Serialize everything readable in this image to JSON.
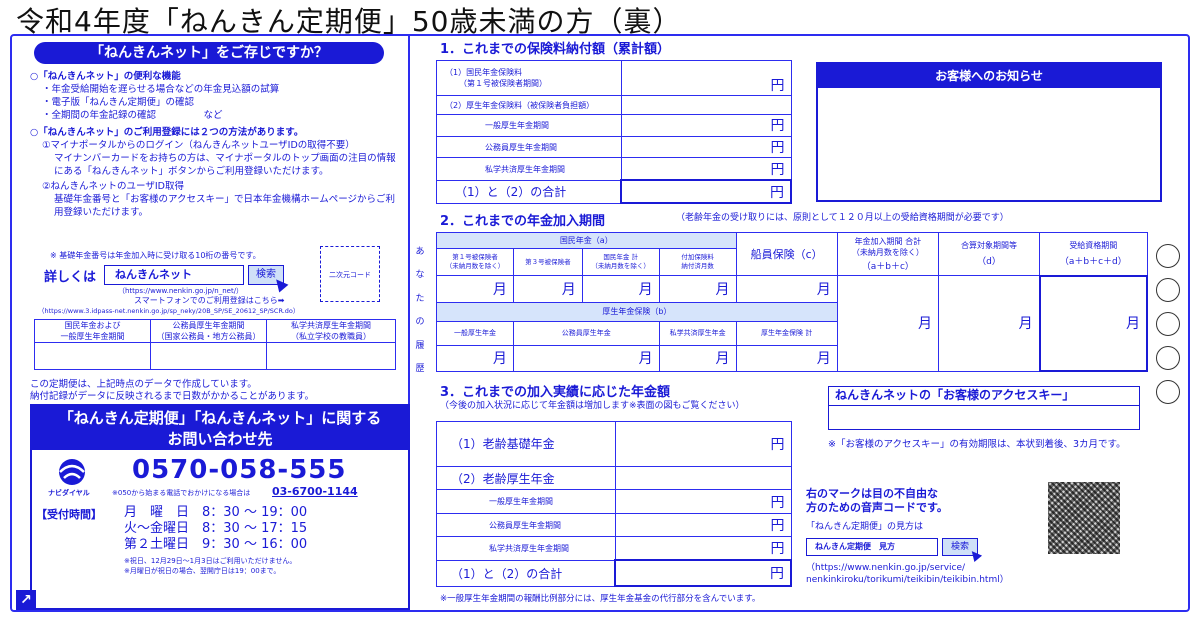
{
  "title": "令和4年度「ねんきん定期便」50歳未満の方（裏）",
  "left": {
    "banner": "「ねんきんネット」をご存じですか？",
    "feature_head": "○「ねんきんネット」の便利な機能",
    "features": [
      "・年金受給開始を遅らせる場合などの年金見込額の試算",
      "・電子版「ねんきん定期便」の確認",
      "・全期間の年金記録の確認　　　　　など"
    ],
    "reg_head": "○「ねんきんネット」のご利用登録には２つの方法があります。",
    "reg1_head": "①マイナポータルからのログイン（ねんきんネットユーザIDの取得不要）",
    "reg1_body": "マイナンバーカードをお持ちの方は、マイナポータルのトップ画面の注目の情報にある「ねんきんネット」ボタンからご利用登録いただけます。",
    "reg2_head": "②ねんきんネットのユーザID取得",
    "reg2_body": "基礎年金番号と「お客様のアクセスキー」で日本年金機構ホームページからご利用登録いただけます。",
    "note_basic": "※ 基礎年金番号は年金加入時に受け取る10桁の番号です。",
    "detail_label": "詳しくは",
    "search_text": "ねんきんネット",
    "search_btn": "検索",
    "qr_label": "二次元コード",
    "url1": "（https://www.nenkin.go.jp/n_net/）",
    "smartphone": "スマートフォンでのご利用登録はこちら➡",
    "url2": "（https://www.3.idpass-net.nenkin.go.jp/sp_neky/20B_SP/SE_20612_SP/SCR.do）",
    "table_heads": [
      "国民年金および\n一般厚生年金期間",
      "公務員厚生年金期間\n（国家公務員・地方公務員）",
      "私学共済厚生年金期間\n（私立学校の教職員）"
    ],
    "note1": "この定期便は、上記時点のデータで作成しています。",
    "note2": "納付記録がデータに反映されるまで日数がかかることがあります。",
    "contact_title1": "「ねんきん定期便」「ねんきんネット」に関する",
    "contact_title2": "お問い合わせ先",
    "navi_label": "ナビダイヤル",
    "phone": "0570-058-555",
    "alt_phone_note": "※050から始まる電話でおかけになる場合は",
    "alt_phone": "03-6700-1144",
    "hours_label": "【受付時間】",
    "hours": [
      {
        "day": "月　曜　日",
        "time": "8：30 〜 19：00"
      },
      {
        "day": "火〜金曜日",
        "time": "8：30 〜 17：15"
      },
      {
        "day": "第２土曜日",
        "time": "9：30 〜 16：00"
      }
    ],
    "hours_note1": "※祝日、12月29日〜1月3日はご利用いただけません。",
    "hours_note2": "※月曜日が祝日の場合、翌開庁日は19：00まで。"
  },
  "sec1": {
    "heading": "1．これまでの保険料納付額（累計額）",
    "r1a": "（1）国民年金保険料",
    "r1b": "（第１号被保険者期間）",
    "r2": "（2）厚生年金保険料（被保険者負担額）",
    "r2a": "一般厚生年金期間",
    "r2b": "公務員厚生年金期間",
    "r2c": "私学共済厚生年金期間",
    "total": "（1）と（2）の合計",
    "yen": "円"
  },
  "notice": {
    "title": "お客様へのお知らせ"
  },
  "sec2": {
    "heading": "2．これまでの年金加入期間",
    "heading_note": "（老齢年金の受け取りには、原則として１２０月以上の受給資格期間が必要です）",
    "kokumin": "国民年金（a）",
    "k1": "第１号被保険者\n（未納月数を除く）",
    "k2": "第３号被保険者",
    "k3": "国民年金 計\n（未納月数を除く）",
    "k4": "付加保険料\n納付済月数",
    "senin": "船員保険（c）",
    "total_head": "年金加入期間 合計\n（未納月数を除く）",
    "total_formula": "（a＋b＋c）",
    "gassan": "合算対象期間等",
    "gassan_d": "（d）",
    "jukyu": "受給資格期間",
    "jukyu_formula": "（a＋b＋c＋d）",
    "kosei": "厚生年金保険（b）",
    "c1": "一般厚生年金",
    "c2": "公務員厚生年金",
    "c3": "私学共済厚生年金",
    "c4": "厚生年金保険 計",
    "month": "月"
  },
  "sec3": {
    "heading": "3．これまでの加入実績に応じた年金額",
    "sub": "（今後の加入状況に応じて年金額は増加します※表面の図もご覧ください）",
    "r1": "（1）老齢基礎年金",
    "r2": "（2）老齢厚生年金",
    "r2a": "一般厚生年金期間",
    "r2b": "公務員厚生年金期間",
    "r2c": "私学共済厚生年金期間",
    "total": "（1）と（2）の合計",
    "yen": "円",
    "footnote": "※一般厚生年金期間の報酬比例部分には、厚生年金基金の代行部分を含んでいます。"
  },
  "access": {
    "title": "ねんきんネットの「お客様のアクセスキー」",
    "note": "※「お客様のアクセスキー」の有効期限は、本状到着後、3カ月です。",
    "voice1": "右のマークは目の不自由な",
    "voice2": "方のための音声コードです。",
    "howto": "「ねんきん定期便」の見方は",
    "search_text": "ねんきん定期便　見方",
    "search_btn": "検索",
    "url1": "（https://www.nenkin.go.jp/service/",
    "url2": "nenkinkiroku/torikumi/teikibin/teikibin.html）"
  },
  "side_chars": [
    "あ",
    "な",
    "た",
    "の",
    "履",
    "歴"
  ]
}
